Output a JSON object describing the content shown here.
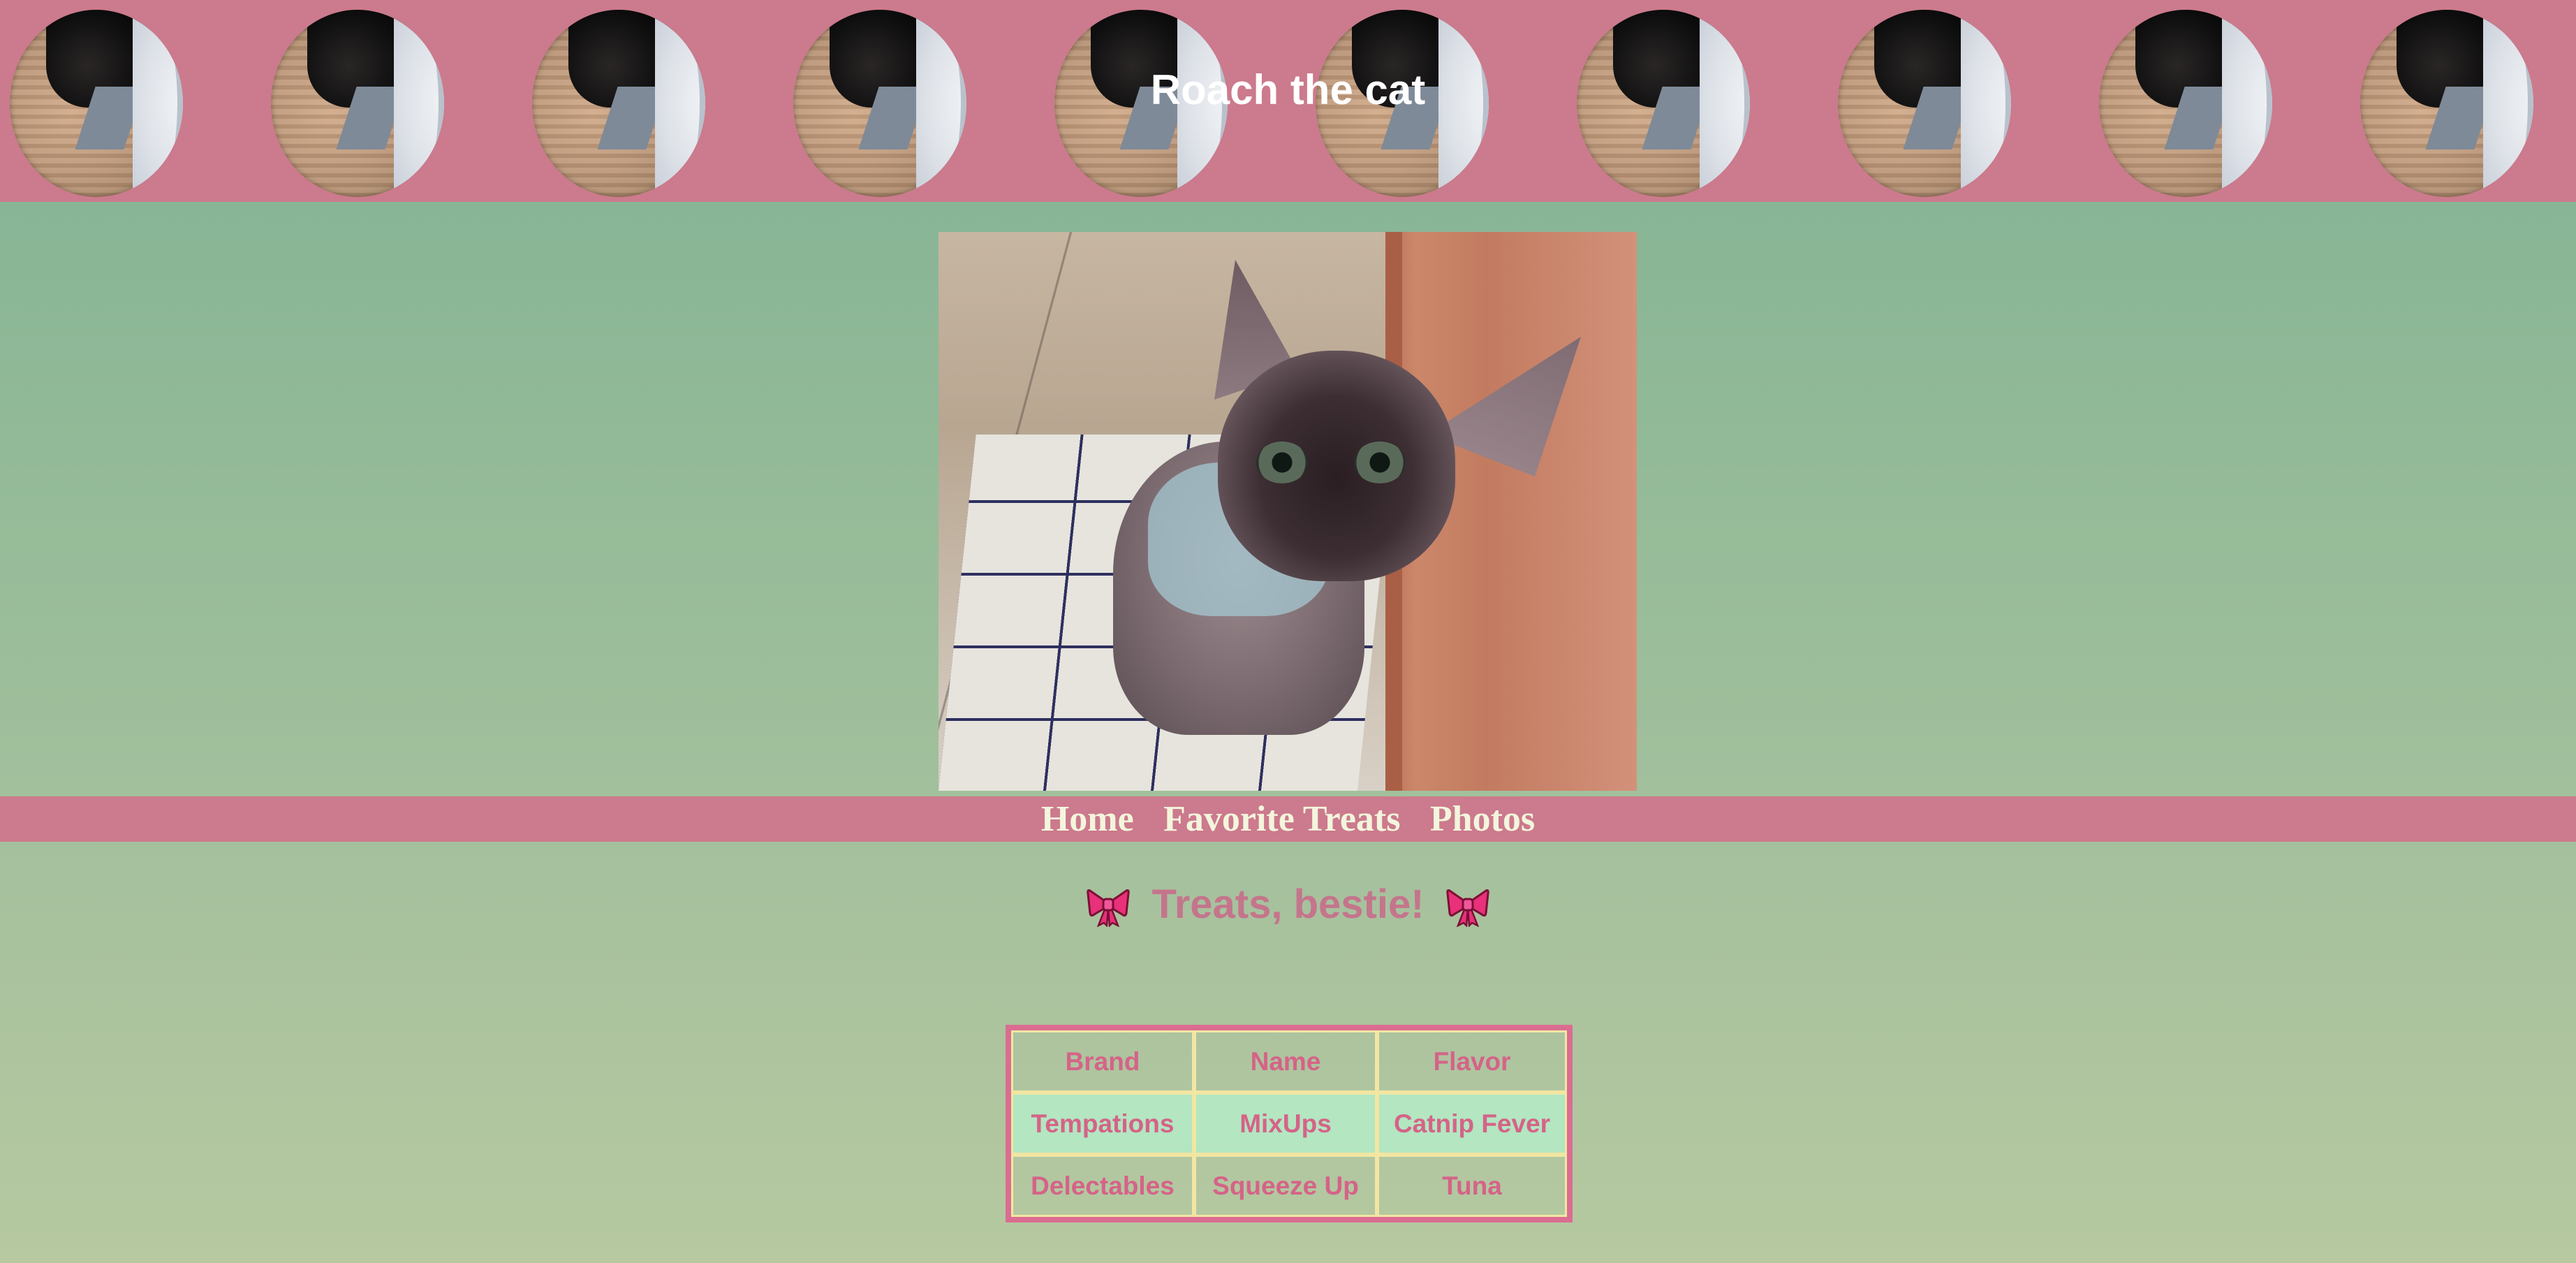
{
  "banner": {
    "title": "Roach the cat",
    "moon_count": 10
  },
  "photo": {
    "subject": "hairless cat"
  },
  "nav": {
    "items": [
      {
        "label": "Home"
      },
      {
        "label": "Favorite Treats"
      },
      {
        "label": "Photos"
      }
    ]
  },
  "heading": {
    "text": "Treats, bestie!",
    "icon": "ribbon-bow-icon"
  },
  "table": {
    "headers": [
      "Brand",
      "Name",
      "Flavor"
    ],
    "rows": [
      [
        "Tempations",
        "MixUps",
        "Catnip Fever"
      ],
      [
        "Delectables",
        "Squeeze Up",
        "Tuna"
      ]
    ]
  },
  "colors": {
    "banner_bg": "#cc7a8d",
    "nav_bg": "#cc7a8d",
    "nav_text": "#f3f5dd",
    "heading_text": "#c4758c",
    "table_text": "#d56388",
    "table_border": "#da6d91",
    "cell_border": "#f2e6a2",
    "alt_row_bg": "#b3e6c1",
    "page_bg_top": "#7fb194",
    "page_bg_bottom": "#b6c9a0"
  }
}
